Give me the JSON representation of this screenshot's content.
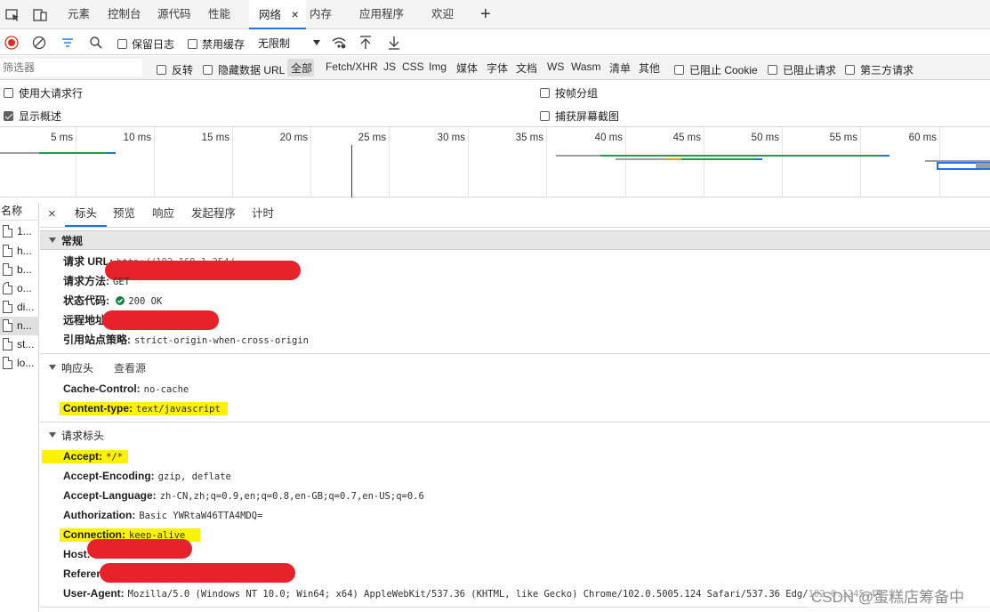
{
  "tabbar": {
    "tabs": [
      "元素",
      "控制台",
      "源代码",
      "性能",
      "网络",
      "内存",
      "应用程序",
      "欢迎"
    ],
    "active_tab": "网络",
    "close_glyph": "×",
    "add_glyph": "+"
  },
  "toolbar": {
    "preserve_log": "保留日志",
    "disable_cache": "禁用缓存",
    "throttle": "无限制"
  },
  "filterbar": {
    "placeholder": "筛选器",
    "invert": "反转",
    "hide_data_urls": "隐藏数据 URL",
    "types": [
      "全部",
      "Fetch/XHR",
      "JS",
      "CSS",
      "Img",
      "媒体",
      "字体",
      "文档",
      "WS",
      "Wasm",
      "清单",
      "其他"
    ],
    "blocked_cookies": "已阻止 Cookie",
    "blocked_requests": "已阻止请求",
    "third_party": "第三方请求"
  },
  "settings": {
    "big_rows": "使用大请求行",
    "show_overview": "显示概述",
    "group_by_frame": "按帧分组",
    "capture_screenshots": "捕获屏幕截图"
  },
  "overview": {
    "ticks": [
      "5 ms",
      "10 ms",
      "15 ms",
      "20 ms",
      "25 ms",
      "30 ms",
      "35 ms",
      "40 ms",
      "45 ms",
      "50 ms",
      "55 ms",
      "60 ms"
    ]
  },
  "reqlist": {
    "header": "名称",
    "items": [
      "1...",
      "h...",
      "b...",
      "o...",
      "di...",
      "n...",
      "st...",
      "lo..."
    ],
    "selected": "n..."
  },
  "details": {
    "close_glyph": "×",
    "tabs": [
      "标头",
      "预览",
      "响应",
      "发起程序",
      "计时"
    ],
    "general": {
      "title": "常规",
      "request_url_key": "请求 URL:",
      "request_url_val": "http://192.168.1.254/...",
      "method_key": "请求方法:",
      "method_val": "GET",
      "status_key": "状态代码:",
      "status_val": "200 OK",
      "remote_key": "远程地址:",
      "referrer_policy_key": "引用站点策略:",
      "referrer_policy_val": "strict-origin-when-cross-origin"
    },
    "response_headers": {
      "title": "响应头",
      "view_source": "查看源",
      "cache_control_key": "Cache-Control:",
      "cache_control_val": "no-cache",
      "content_type_key": "Content-type:",
      "content_type_val": "text/javascript"
    },
    "request_headers": {
      "title": "请求标头",
      "accept_key": "Accept:",
      "accept_val": "*/*",
      "accept_encoding_key": "Accept-Encoding:",
      "accept_encoding_val": "gzip, deflate",
      "accept_language_key": "Accept-Language:",
      "accept_language_val": "zh-CN,zh;q=0.9,en;q=0.8,en-GB;q=0.7,en-US;q=0.6",
      "authorization_key": "Authorization:",
      "authorization_val": "Basic YWRtaW46TTA4MDQ=",
      "connection_key": "Connection:",
      "connection_val": "keep-alive",
      "host_key": "Host:",
      "referer_key": "Referer:",
      "user_agent_key": "User-Agent:",
      "user_agent_val": "Mozilla/5.0 (Windows NT 10.0; Win64; x64) AppleWebKit/537.36 (KHTML, like Gecko) Chrome/102.0.5005.124 Safari/537.36 Edg/102.0.1245.44"
    }
  },
  "watermark": "CSDN @蛋糕店筹备中",
  "colors": {
    "accent": "#1a73e8",
    "record": "#d93025",
    "highlight": "#fff200",
    "redaction": "#e8222a",
    "status_ok": "#188038"
  }
}
